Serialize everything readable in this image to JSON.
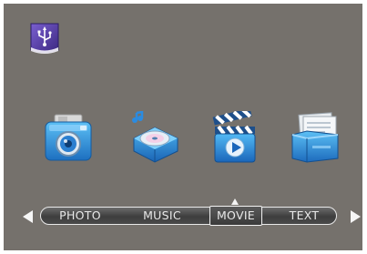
{
  "source": {
    "icon": "usb-icon"
  },
  "media_icons": [
    {
      "name": "camera-icon"
    },
    {
      "name": "music-disc-icon"
    },
    {
      "name": "clapperboard-icon"
    },
    {
      "name": "document-icon"
    }
  ],
  "menu": {
    "items": [
      {
        "label": "PHOTO"
      },
      {
        "label": "MUSIC"
      },
      {
        "label": "MOVIE"
      },
      {
        "label": "TEXT"
      }
    ],
    "selected": "MOVIE",
    "left_arrow": "left-arrow-icon",
    "right_arrow": "right-arrow-icon"
  },
  "colors": {
    "background": "#75716c",
    "icon_blue": "#2a8fd8",
    "usb_purple": "#5b3fa6"
  }
}
